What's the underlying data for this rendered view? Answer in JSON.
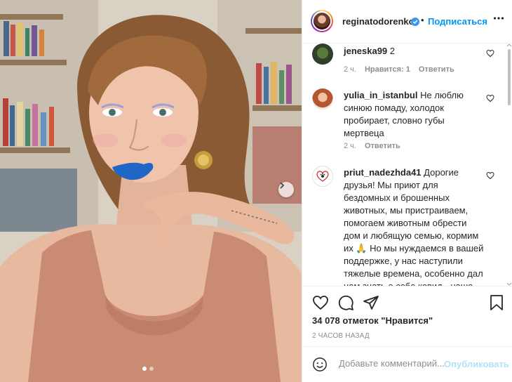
{
  "post": {
    "author": "reginatodorenko",
    "follow_label": "Подписаться",
    "follow_separator": "•",
    "more_icon": "more-options-icon",
    "accent": "#0095f6"
  },
  "comments": [
    {
      "username": "jeneska99",
      "text": "2",
      "time": "2 ч.",
      "likes": "Нравится: 1",
      "reply": "Ответить"
    },
    {
      "username": "yulia_in_istanbul",
      "text": "Не люблю синюю помаду, холодок пробирает, словно губы мертвеца",
      "time": "2 ч.",
      "reply": "Ответить"
    },
    {
      "username": "priut_nadezhda41",
      "text": "Дорогие друзья! Мы приют для бездомных и брошенных животных, мы пристраиваем, помогаем животным обрести дом и любящую семью, кормим их 🙏 Но мы нуждаемся в вашей поддержке, у нас наступили тяжелые времена, особенно дал нам знать о себе ковид - наша"
    }
  ],
  "actions": {
    "likes_text": "34 078 отметок \"Нравится\"",
    "timestamp": "2 ЧАСОВ НАЗАД"
  },
  "composer": {
    "placeholder": "Добавьте комментарий...",
    "publish_label": "Опубликовать"
  },
  "carousel": {
    "current": 1,
    "total": 2
  }
}
